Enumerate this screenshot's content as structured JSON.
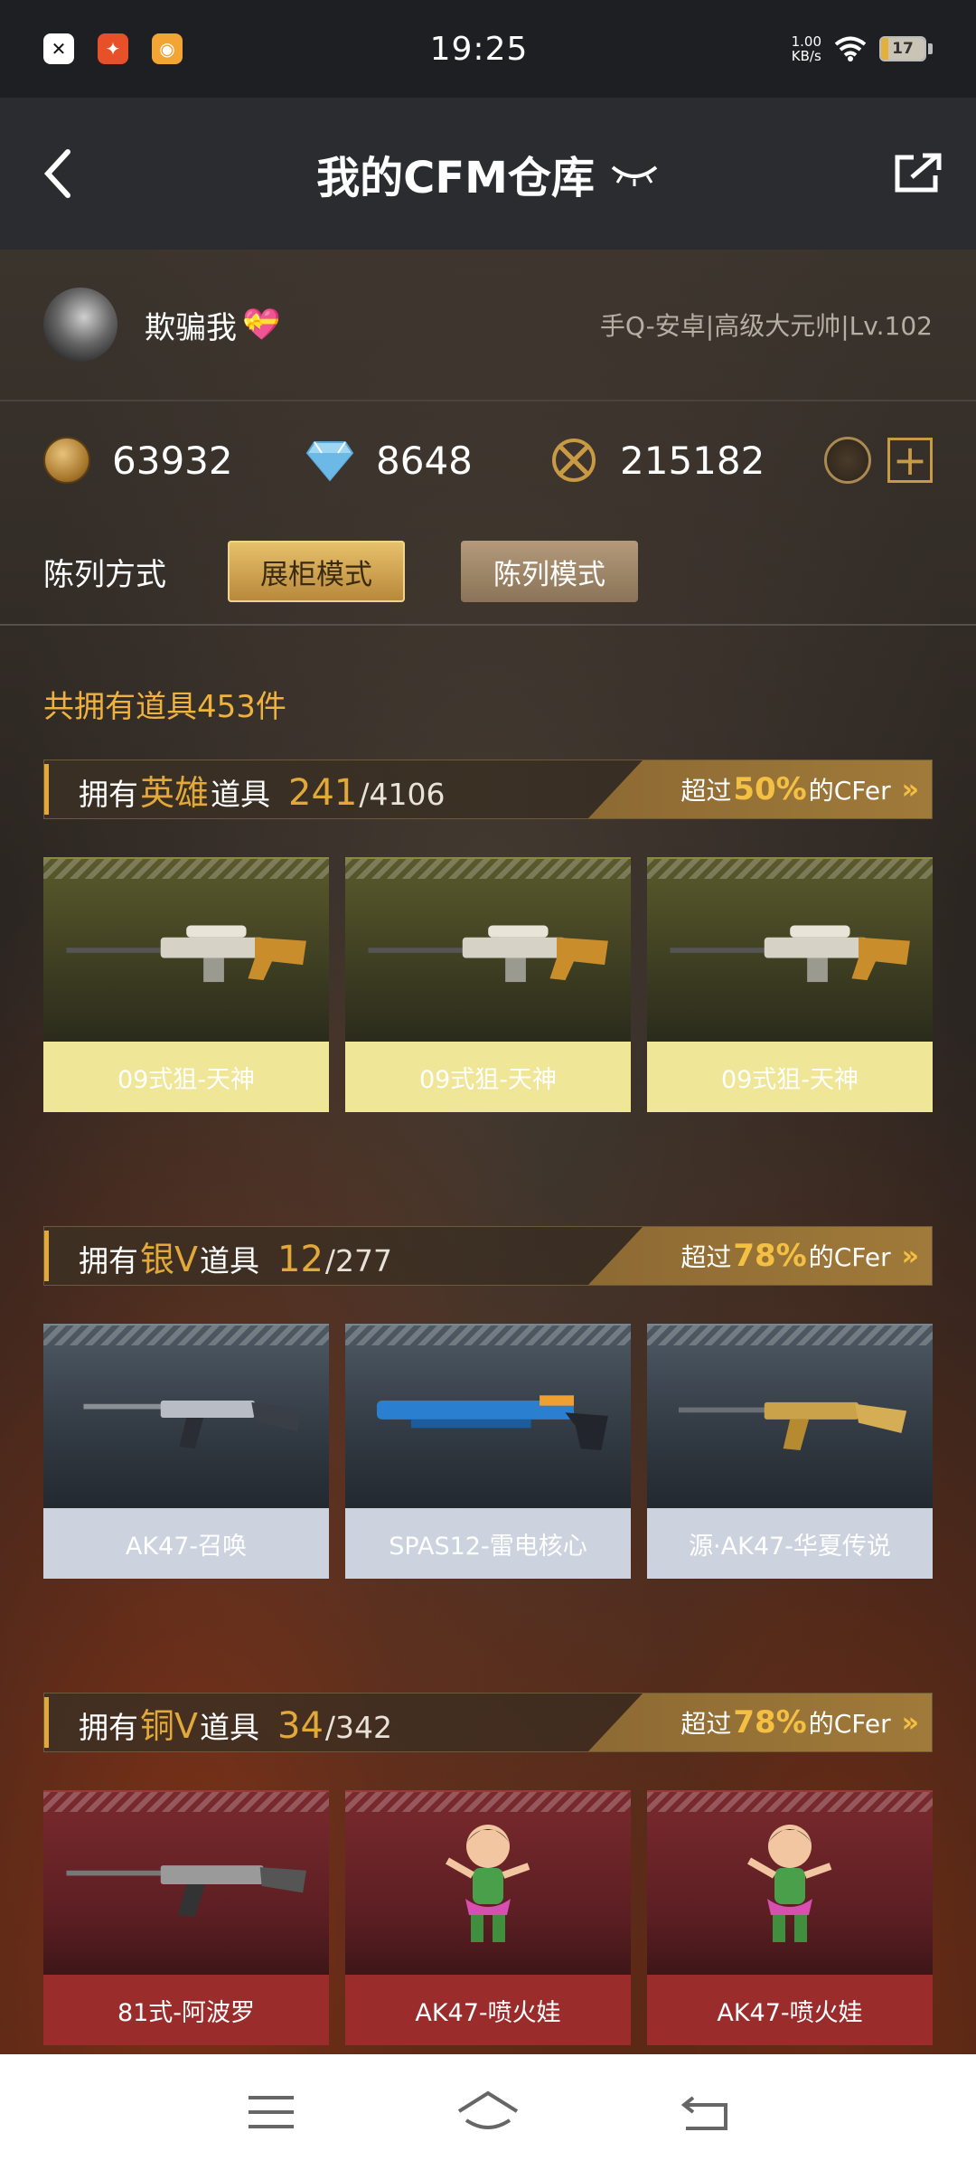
{
  "status": {
    "time": "19:25",
    "net_speed_value": "1.00",
    "net_speed_unit": "KB/s",
    "battery": "17",
    "apps": [
      "close-app-icon",
      "cf-app-icon",
      "camera-app-icon"
    ]
  },
  "header": {
    "title": "我的CFM仓库"
  },
  "profile": {
    "nickname": "欺骗我",
    "account_info": "手Q-安卓|高级大元帅|Lv.102"
  },
  "currencies": [
    {
      "icon": "gold-coin-icon",
      "value": "63932"
    },
    {
      "icon": "diamond-icon",
      "value": "8648"
    },
    {
      "icon": "crossed-coin-icon",
      "value": "215182"
    }
  ],
  "display": {
    "label": "陈列方式",
    "mode_showcase": "展柜模式",
    "mode_list": "陈列模式"
  },
  "total_items": "共拥有道具453件",
  "sections": [
    {
      "prefix": "拥有",
      "tier": "英雄",
      "suffix": "道具",
      "count": "241",
      "total": "/4106",
      "rank_prefix": "超过",
      "rank_pct": "50%",
      "rank_suffix": "的CFer",
      "items": [
        "09式狙-天神",
        "09式狙-天神",
        "09式狙-天神"
      ]
    },
    {
      "prefix": "拥有",
      "tier": "银V",
      "suffix": "道具",
      "count": "12",
      "total": "/277",
      "rank_prefix": "超过",
      "rank_pct": "78%",
      "rank_suffix": "的CFer",
      "items": [
        "AK47-召唤",
        "SPAS12-雷电核心",
        "源·AK47-华夏传说"
      ]
    },
    {
      "prefix": "拥有",
      "tier": "铜V",
      "suffix": "道具",
      "count": "34",
      "total": "/342",
      "rank_prefix": "超过",
      "rank_pct": "78%",
      "rank_suffix": "的CFer",
      "items": [
        "81式-阿波罗",
        "AK47-喷火娃",
        "AK47-喷火娃"
      ]
    }
  ],
  "colors": {
    "accent_gold": "#e2a93a",
    "hero_label_bg": "#efe697",
    "silver_label_bg": "#cdd3de",
    "bronze_label_bg": "#9a2c2c"
  }
}
